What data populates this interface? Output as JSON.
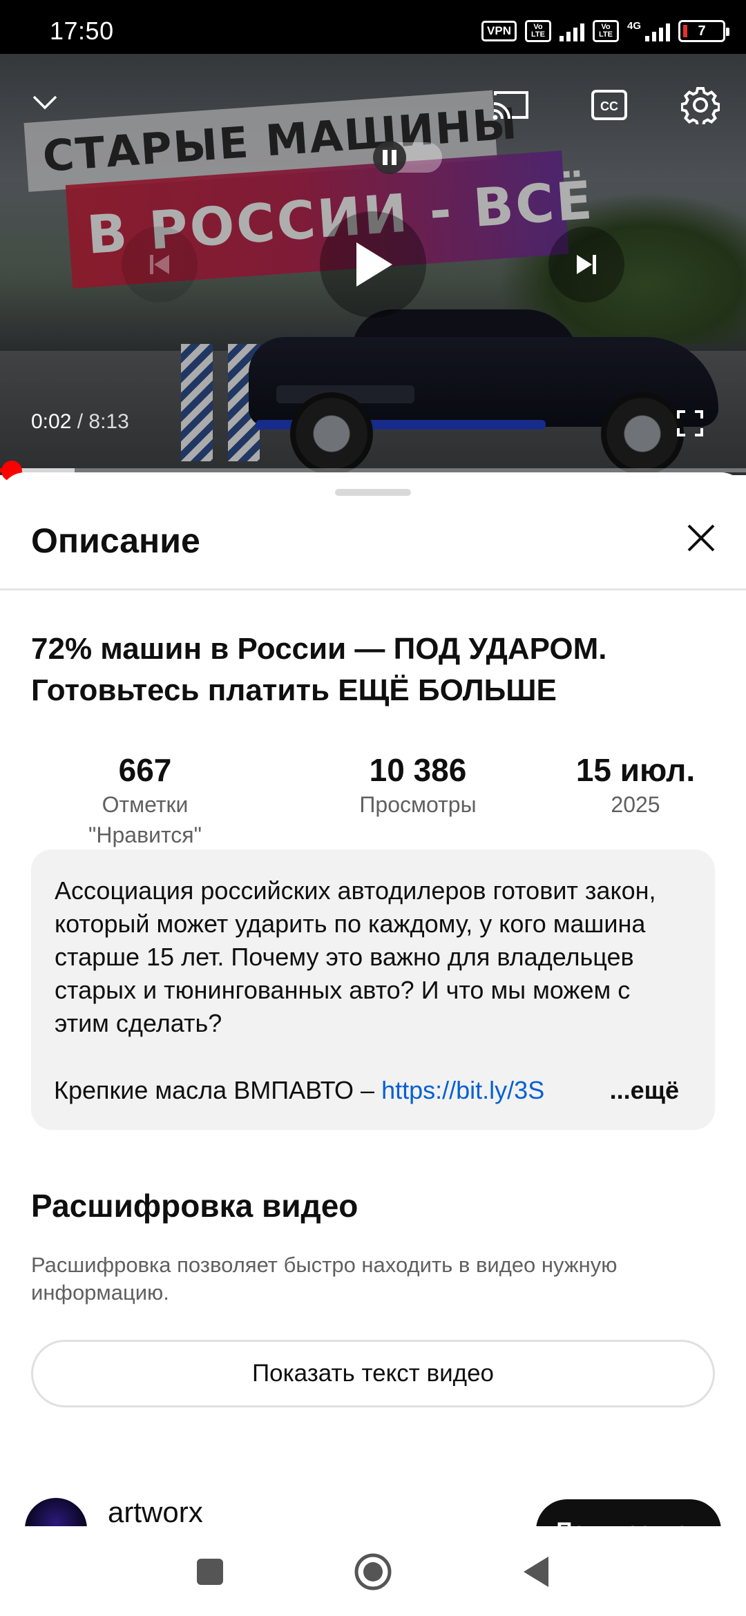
{
  "status_bar": {
    "time": "17:50",
    "vpn": "VPN",
    "volte1": "Vo\nLTE",
    "volte2": "Vo\nLTE",
    "network": "4G",
    "battery": "7"
  },
  "player": {
    "thumbnail_line1": "СТАРЫЕ МАШИНЫ",
    "thumbnail_line2": "В РОССИИ - ВСЁ",
    "current_time": "0:02",
    "separator": " / ",
    "duration": "8:13",
    "progress": 0.004
  },
  "sheet": {
    "title": "Описание",
    "video_title": "72% машин в России — ПОД УДАРОМ. Готовьтесь платить ЕЩЁ БОЛЬШЕ",
    "stats": [
      {
        "value": "667",
        "label": "Отметки \"Нравится\""
      },
      {
        "value": "10 386",
        "label": "Просмотры"
      },
      {
        "value": "15 июл.",
        "label": "2025"
      }
    ],
    "description": "Ассоциация российских автодилеров готовит закон, который может ударить по каждому, у кого машина старше 15 лет. Почему это важно для владельцев старых и тюнингованных авто? И что мы можем с этим сделать?",
    "promo_text": "Крепкие масла ВМПАВТО – ",
    "promo_link": "https://bit.ly/3S",
    "more_label": "...ещё",
    "transcript_title": "Расшифровка видео",
    "transcript_sub": "Расшифровка позволяет быстро находить в видео нужную информацию.",
    "transcript_button": "Показать текст видео",
    "channel_name": "artworx",
    "subscribe_label": "Подписаться"
  },
  "colors": {
    "progress": "#ff0000",
    "link": "#065fd4"
  }
}
